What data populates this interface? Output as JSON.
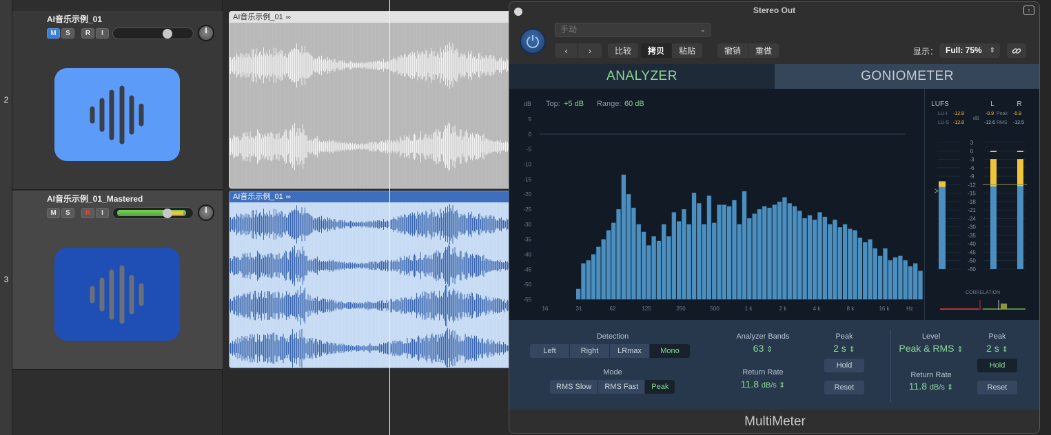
{
  "tracks": [
    {
      "number": "2",
      "name": "AI音乐示例_01",
      "buttons": [
        "M",
        "S",
        "R",
        "I"
      ],
      "region_name": "AI音乐示例_01"
    },
    {
      "number": "3",
      "name": "AI音乐示例_01_Mastered",
      "buttons": [
        "M",
        "S",
        "R",
        "I"
      ],
      "region_name": "AI音乐示例_01"
    }
  ],
  "plugin": {
    "window_title": "Stereo Out",
    "preset": "手动",
    "toolbar": {
      "compare": "比较",
      "copy": "拷贝",
      "paste": "粘贴",
      "undo": "撤销",
      "redo": "重做"
    },
    "view_label": "显示：",
    "view_value": "Full: 75%",
    "tabs": [
      "ANALYZER",
      "GONIOMETER"
    ],
    "analyzer": {
      "unit_label": "dB",
      "top_label": "Top:",
      "top_value": "+5 dB",
      "range_label": "Range:",
      "range_value": "60 dB",
      "y_ticks": [
        "5",
        "0",
        "-5",
        "-10",
        "-15",
        "-20",
        "-25",
        "-30",
        "-35",
        "-40",
        "-45",
        "-50",
        "-55"
      ],
      "x_ticks": [
        "16",
        "31",
        "62",
        "125",
        "250",
        "500",
        "1 k",
        "2 k",
        "4 k",
        "8 k",
        "16 k",
        "Hz"
      ],
      "bands_db": [
        -51.5,
        -43,
        -42,
        -40,
        -37.5,
        -35,
        -32,
        -29.5,
        -25,
        -13.5,
        -20,
        -24.5,
        -30,
        -32.5,
        -37,
        -34,
        -35.5,
        -30,
        -34,
        -26,
        -29,
        -25,
        -30,
        -19.5,
        -23,
        -30,
        -20.5,
        -29.5,
        -23.5,
        -23.5,
        -24,
        -22,
        -30,
        -19,
        -28,
        -26.5,
        -25,
        -24,
        -24.5,
        -23.5,
        -22.5,
        -21,
        -23,
        -24,
        -25.5,
        -28,
        -27,
        -28.5,
        -26,
        -27.5,
        -30,
        -28.5,
        -31,
        -30,
        -31.5,
        -32,
        -34.5,
        -36,
        -35,
        -38,
        -40.5,
        -38,
        -42,
        -41,
        -40.5,
        -42,
        -44,
        -43,
        -45.5,
        -48,
        -51.5
      ]
    },
    "meters": {
      "lufs_label": "LUFS",
      "l_label": "L",
      "r_label": "R",
      "lu_i_label": "LU-I",
      "lu_i_value": "-12.8",
      "lu_s_label": "LU-S",
      "lu_s_value": "-12.8",
      "db_label": "dB",
      "peak_label": "Peak",
      "rms_label": "RMS",
      "l_peak": "-0.9",
      "r_peak": "-0.9",
      "l_rms": "-12.6",
      "r_rms": "-12.5",
      "scale_ticks": [
        "3",
        "0",
        "-3",
        "-6",
        "-9",
        "-12",
        "-15",
        "-18",
        "-21",
        "-24",
        "-30",
        "-35",
        "-40",
        "-45",
        "-50",
        "-60"
      ],
      "correlation_label": "CORRELATION",
      "loudness_level": -12.8,
      "l_peak_level": -0.9,
      "r_peak_level": -0.9,
      "l_rms_level": -12.6,
      "r_rms_level": -12.5
    },
    "controls": {
      "detection_label": "Detection",
      "detection_options": [
        "Left",
        "Right",
        "LRmax",
        "Mono"
      ],
      "detection_selected": "Mono",
      "mode_label": "Mode",
      "mode_options": [
        "RMS Slow",
        "RMS Fast",
        "Peak"
      ],
      "mode_selected": "Peak",
      "analyzer_bands_label": "Analyzer Bands",
      "analyzer_bands_value": "63",
      "return_rate_label": "Return Rate",
      "return_rate_value": "11.8",
      "return_rate_unit": "dB/s",
      "peak_label": "Peak",
      "peak_value": "2 s",
      "hold_label": "Hold",
      "reset_label": "Reset",
      "level_label": "Level",
      "level_value": "Peak & RMS",
      "peak2_label": "Peak",
      "peak2_value": "2 s",
      "return_rate2_label": "Return Rate",
      "return_rate2_value": "11.8",
      "return_rate2_unit": "dB/s",
      "hold2_label": "Hold",
      "reset2_label": "Reset"
    },
    "footer": "MultiMeter"
  },
  "colors": {
    "accent_green": "#8ad694",
    "bar_blue": "#4a8fc0",
    "meter_yellow": "#f0c43a",
    "track_icon_light": "#5d9bf8",
    "track_icon_dark": "#1f4fb5"
  }
}
